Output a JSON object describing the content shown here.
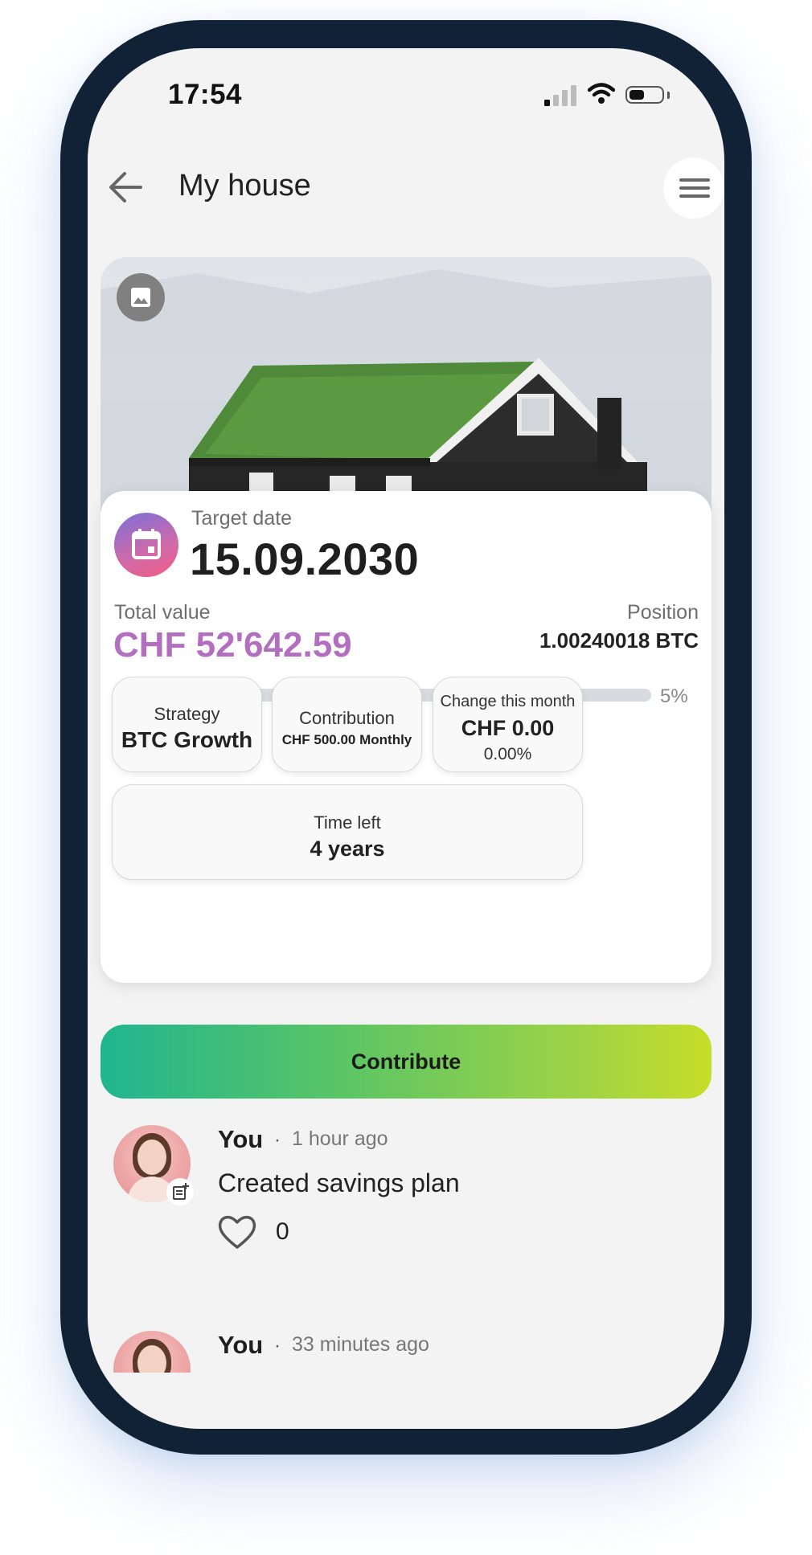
{
  "status_bar": {
    "time": "17:54"
  },
  "header": {
    "title": "My house"
  },
  "goal": {
    "target_date_label": "Target date",
    "target_date": "15.09.2030",
    "total_value_label": "Total value",
    "total_value": "CHF 52'642.59",
    "position_label": "Position",
    "position_value": "1.00240018 BTC",
    "progress_percent": 5,
    "progress_label": "5%"
  },
  "tiles": {
    "strategy": {
      "label": "Strategy",
      "value": "BTC Growth"
    },
    "contribution": {
      "label": "Contribution",
      "value": "CHF 500.00 Monthly"
    },
    "change": {
      "label": "Change this month",
      "value": "CHF 0.00",
      "percent": "0.00%"
    },
    "time_left": {
      "label": "Time left",
      "value": "4 years"
    }
  },
  "actions": {
    "contribute_label": "Contribute"
  },
  "feed": [
    {
      "name": "You",
      "separator": "·",
      "time": "1 hour ago",
      "text": "Created savings plan",
      "likes": "0"
    },
    {
      "name": "You",
      "separator": "·",
      "time": "33 minutes ago"
    }
  ],
  "icons": {
    "back": "arrow-left-icon",
    "menu": "hamburger-menu-icon",
    "photo": "image-icon",
    "calendar": "calendar-icon",
    "like": "heart-outline-icon",
    "post": "note-add-icon"
  },
  "colors": {
    "accent_purple": "#b36fbf",
    "gradient_start": "#1fb58f",
    "gradient_end": "#c6de28",
    "frame": "#112236"
  }
}
